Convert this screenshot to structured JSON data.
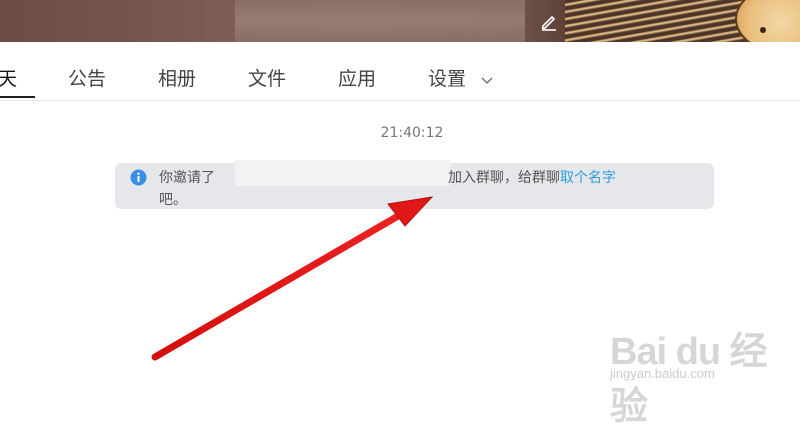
{
  "tabs": [
    {
      "label": "聊天",
      "active": true
    },
    {
      "label": "公告",
      "active": false
    },
    {
      "label": "相册",
      "active": false
    },
    {
      "label": "文件",
      "active": false
    },
    {
      "label": "应用",
      "active": false
    },
    {
      "label": "设置",
      "active": false
    }
  ],
  "tab_first_visible": "天",
  "chat": {
    "timestamp": "21:40:12",
    "notice": {
      "prefix": "你邀请了",
      "suffix": "加入群聊，给群聊",
      "link_text": "取个名字",
      "line2": "吧。"
    }
  },
  "watermark": {
    "main": "Bai du 经验",
    "sub": "jingyan.baidu.com"
  },
  "colors": {
    "accent_link": "#2a9de0",
    "arrow": "#e01818",
    "notice_bg": "#e5e7ea"
  },
  "icons": [
    "edit-icon",
    "info-icon",
    "chevron-down-icon"
  ]
}
